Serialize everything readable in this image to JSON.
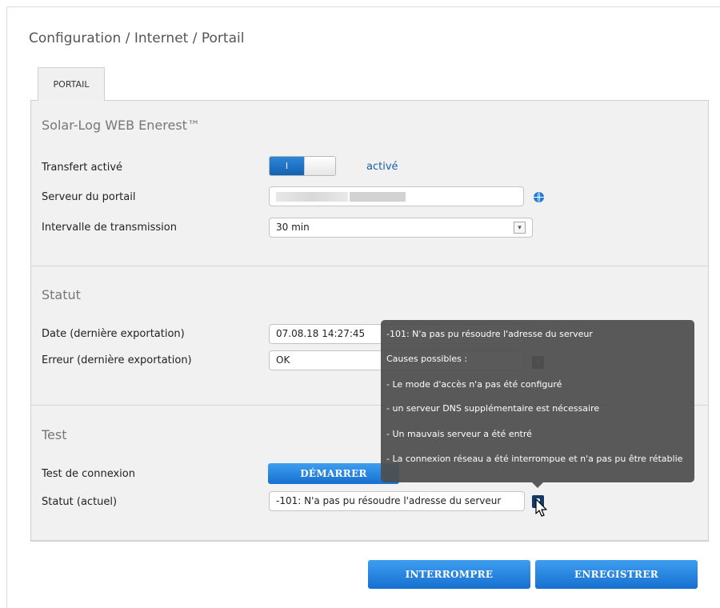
{
  "breadcrumb": "Configuration / Internet / Portail",
  "tab": {
    "label": "PORTAIL"
  },
  "portal_section": {
    "title": "Solar-Log WEB Enerest™",
    "transfer_label": "Transfert activé",
    "toggle_on_label": "I",
    "transfer_status": "activé",
    "server_label": "Serveur du portail",
    "interval_label": "Intervalle de transmission",
    "interval_value": "30 min"
  },
  "status_section": {
    "title": "Statut",
    "date_label": "Date (dernière exportation)",
    "date_value": "07.08.18 14:27:45",
    "error_label": "Erreur (dernière exportation)",
    "error_value": "OK"
  },
  "test_section": {
    "title": "Test",
    "connection_label": "Test de connexion",
    "start_button": "DÉMARRER",
    "current_status_label": "Statut (actuel)",
    "current_status_value": "-101: N'a pas pu résoudre l'adresse du serveur"
  },
  "help_icon_glyph": "?",
  "tooltip": {
    "lines": [
      "-101: N'a pas pu résoudre l'adresse du serveur",
      "Causes possibles :",
      "- Le mode d'accès n'a pas été configuré",
      "- un serveur DNS supplémentaire est nécessaire",
      "- Un mauvais serveur a été entré",
      "- La connexion réseau a été interrompue et n'a pas pu être rétablie"
    ]
  },
  "footer": {
    "cancel_button": "INTERROMPRE",
    "save_button": "ENREGISTRER"
  },
  "colors": {
    "accent": "#1670cf",
    "link": "#1a5fb0",
    "tooltip_bg": "#4e4e4e"
  }
}
